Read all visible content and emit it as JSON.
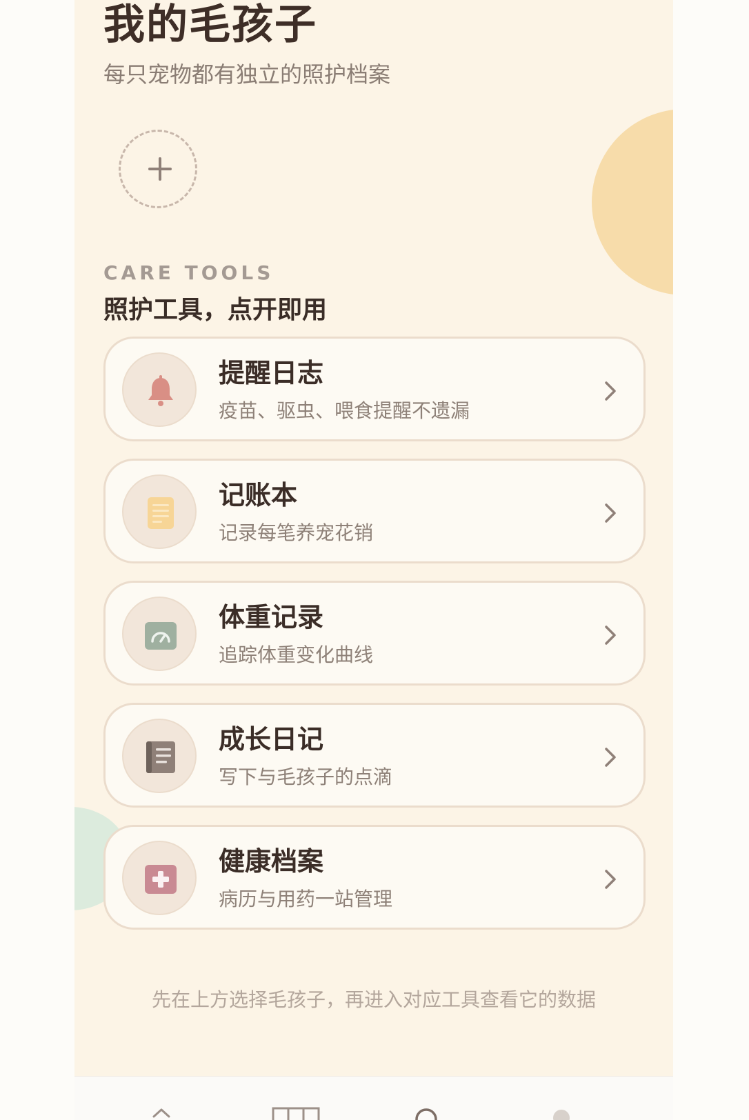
{
  "header": {
    "title": "我的毛孩子",
    "subtitle": "每只宠物都有独立的照护档案"
  },
  "pets": {
    "add_icon": "plus-icon"
  },
  "tools_section": {
    "eyebrow": "CARE TOOLS",
    "title": "照护工具，点开即用",
    "items": [
      {
        "title": "提醒日志",
        "description": "疫苗、驱虫、喂食提醒不遗漏",
        "icon": "bell-icon",
        "icon_color": "#d98f85"
      },
      {
        "title": "记账本",
        "description": "记录每笔养宠花销",
        "icon": "notepad-icon",
        "icon_color": "#f7d596"
      },
      {
        "title": "体重记录",
        "description": "追踪体重变化曲线",
        "icon": "scale-icon",
        "icon_color": "#9fb0a0"
      },
      {
        "title": "成长日记",
        "description": "写下与毛孩子的点滴",
        "icon": "journal-icon",
        "icon_color": "#8f8078"
      },
      {
        "title": "健康档案",
        "description": "病历与用药一站管理",
        "icon": "medical-kit-icon",
        "icon_color": "#c98a93"
      }
    ]
  },
  "footer_hint": "先在上方选择毛孩子，再进入对应工具查看它的数据",
  "colors": {
    "background": "#fcf4e6",
    "card_border": "#ebdccc",
    "title_text": "#3b2d27",
    "muted_text": "#8e8178",
    "accent_orange": "#f7dcaa",
    "accent_green": "#dcebdd"
  },
  "tabbar": {
    "icons": [
      "home-icon",
      "grid-icon",
      "search-icon",
      "profile-icon"
    ]
  }
}
